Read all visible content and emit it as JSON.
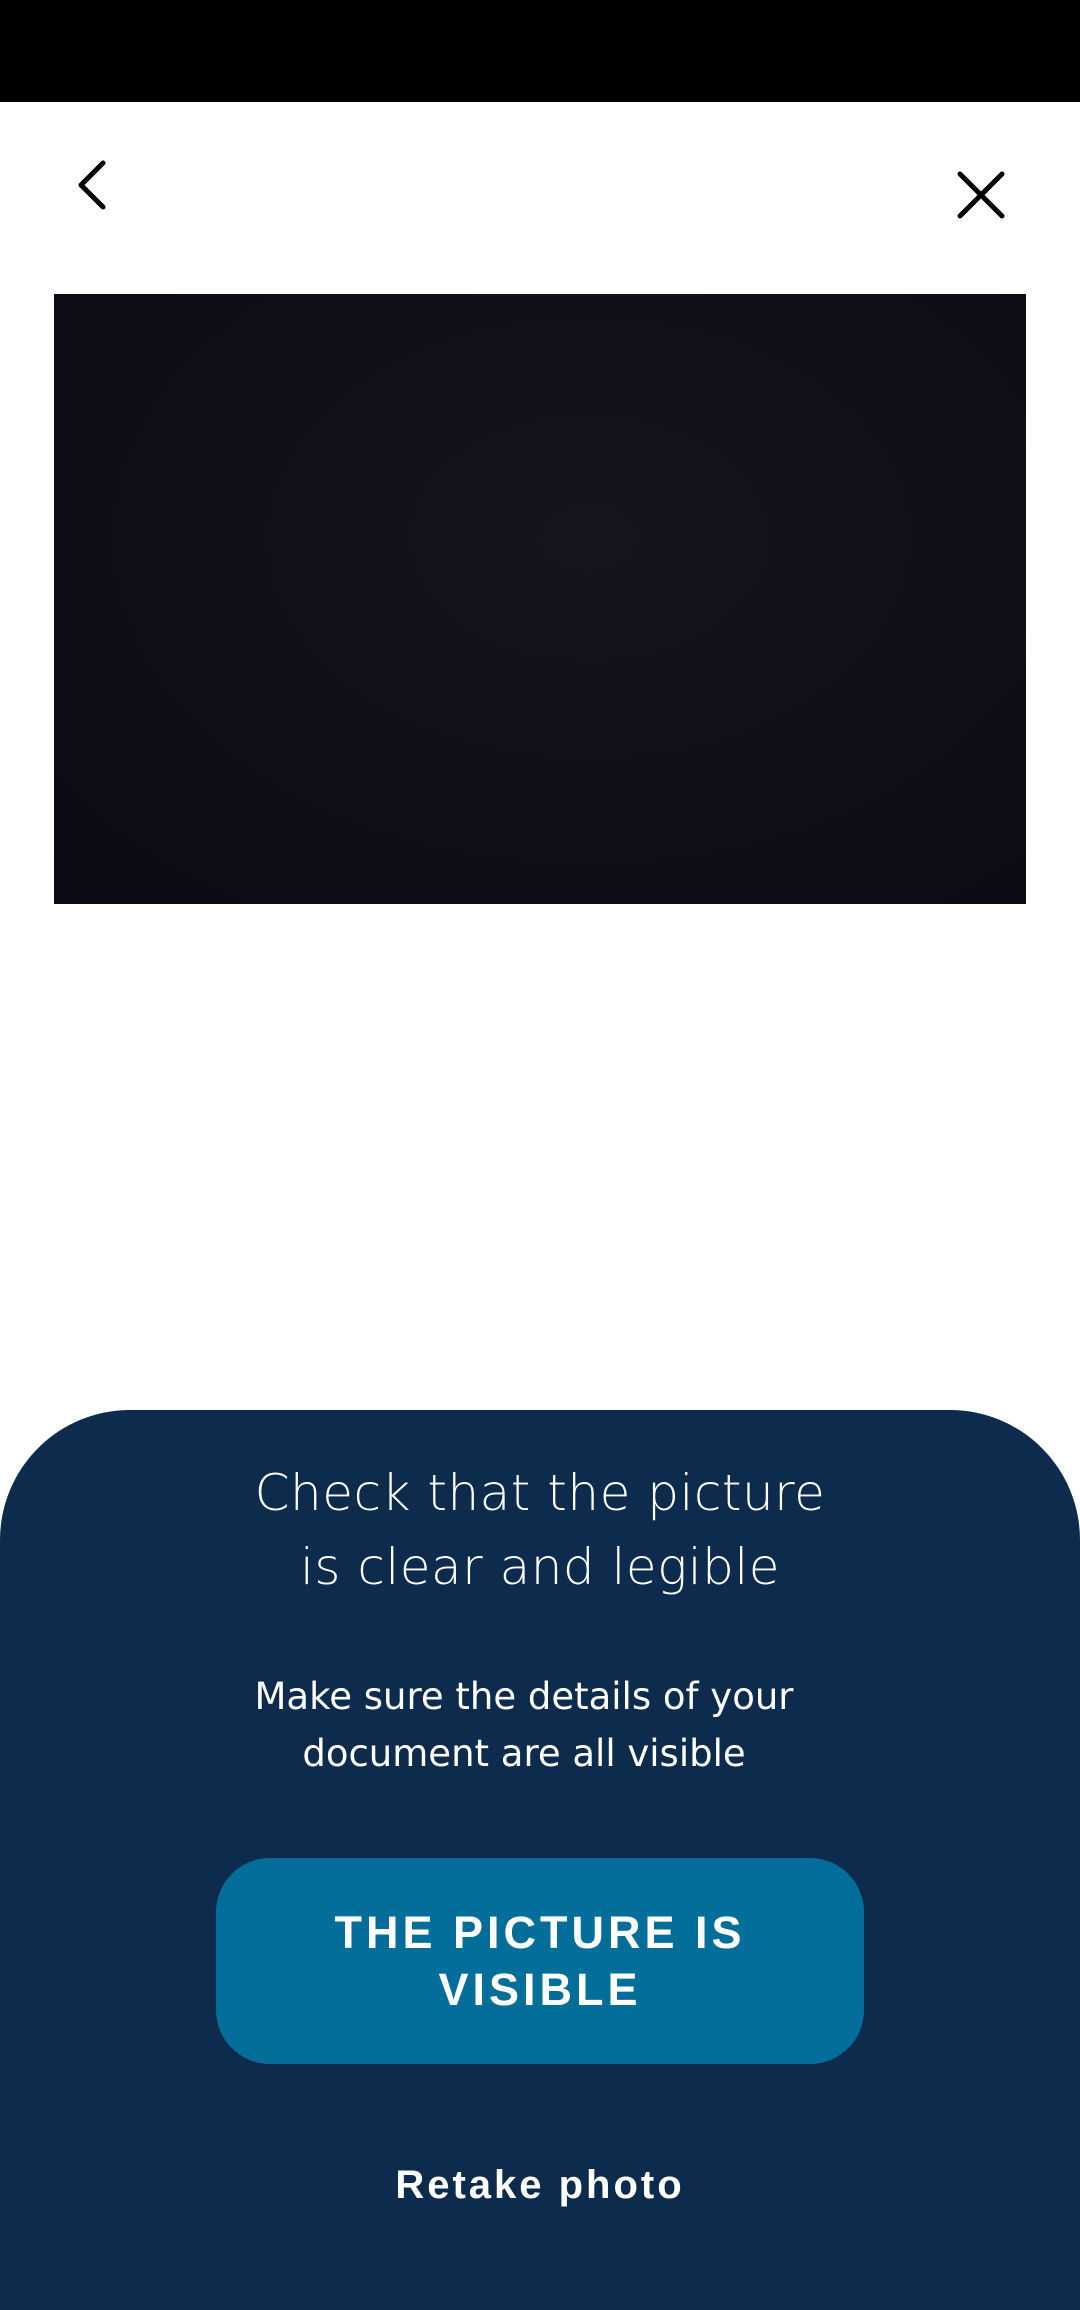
{
  "nav": {
    "back_icon": "chevron-left-icon",
    "close_icon": "close-icon"
  },
  "preview": {
    "description_color": "#110e18"
  },
  "sheet": {
    "title": "Check that the picture\nis clear and legible",
    "subtitle": "Make sure the details of your\ndocument are all visible",
    "confirm_button_label": "THE PICTURE IS VISIBLE",
    "retake_button_label": "Retake photo"
  },
  "colors": {
    "status_bar": "#000000",
    "sheet_background": "#0d2b4d",
    "primary_button": "#036e99",
    "text_light": "#ffffff"
  }
}
